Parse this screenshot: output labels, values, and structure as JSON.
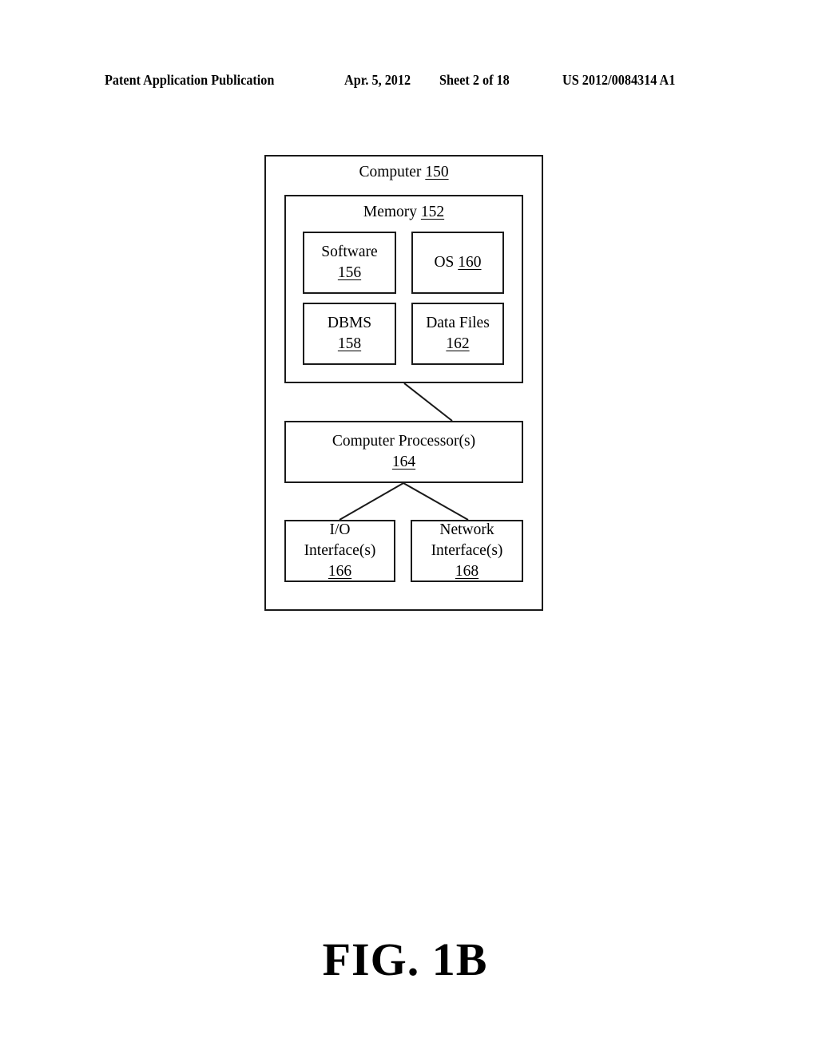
{
  "header": {
    "publication": "Patent Application Publication",
    "date": "Apr. 5, 2012",
    "sheet": "Sheet 2 of 18",
    "number": "US 2012/0084314 A1"
  },
  "diagram": {
    "computer": {
      "label": "Computer",
      "ref": "150"
    },
    "memory": {
      "label": "Memory",
      "ref": "152"
    },
    "software": {
      "label": "Software",
      "ref": "156"
    },
    "os": {
      "label": "OS",
      "ref": "160"
    },
    "dbms": {
      "label": "DBMS",
      "ref": "158"
    },
    "data_files": {
      "label": "Data Files",
      "ref": "162"
    },
    "processor": {
      "label": "Computer Processor(s)",
      "ref": "164"
    },
    "io_interface": {
      "label_line1": "I/O",
      "label_line2": "Interface(s)",
      "ref": "166"
    },
    "network_interface": {
      "label_line1": "Network",
      "label_line2": "Interface(s)",
      "ref": "168"
    },
    "connections": [
      {
        "from": "memory",
        "to": "processor"
      },
      {
        "from": "processor",
        "to": "io_interface"
      },
      {
        "from": "processor",
        "to": "network_interface"
      }
    ]
  },
  "figure_label": "FIG. 1B"
}
